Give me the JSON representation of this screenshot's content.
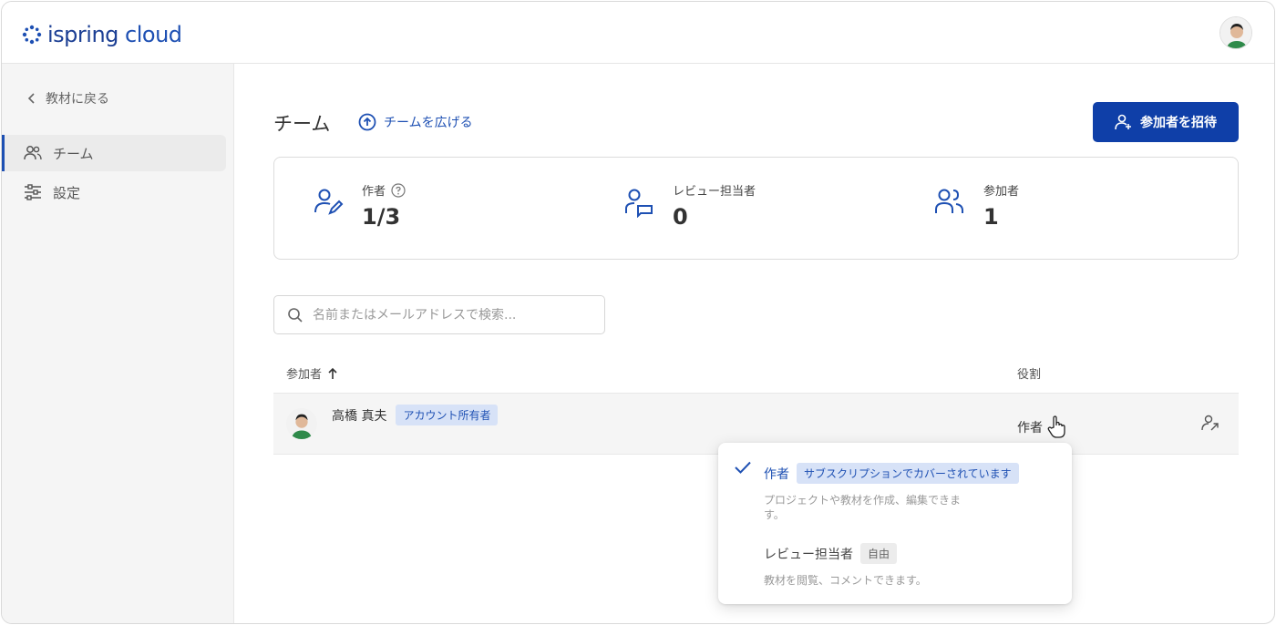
{
  "app": {
    "logo_main": "ispring",
    "logo_sub": "cloud"
  },
  "sidebar": {
    "back_label": "教材に戻る",
    "items": [
      {
        "label": "チーム",
        "icon": "users-icon",
        "active": true
      },
      {
        "label": "設定",
        "icon": "sliders-icon",
        "active": false
      }
    ]
  },
  "header": {
    "title": "チーム",
    "expand_label": "チームを広げる",
    "invite_label": "参加者を招待"
  },
  "stats": [
    {
      "label": "作者",
      "value": "1/3",
      "icon": "user-edit-icon",
      "has_help": true
    },
    {
      "label": "レビュー担当者",
      "value": "0",
      "icon": "user-comment-icon",
      "has_help": false
    },
    {
      "label": "参加者",
      "value": "1",
      "icon": "users-icon",
      "has_help": false
    }
  ],
  "search": {
    "placeholder": "名前またはメールアドレスで検索..."
  },
  "table": {
    "col_member": "参加者",
    "col_role": "役割",
    "rows": [
      {
        "name": "高橋 真夫",
        "badge": "アカウント所有者",
        "role": "作者"
      }
    ]
  },
  "role_menu": {
    "options": [
      {
        "title": "作者",
        "badge": "サブスクリプションでカバーされています",
        "desc": "プロジェクトや教材を作成、編集できます。",
        "selected": true
      },
      {
        "title": "レビュー担当者",
        "badge": "自由",
        "desc": "教材を閲覧、コメントできます。",
        "selected": false
      }
    ]
  },
  "colors": {
    "brand": "#1e50b3",
    "button": "#0f3fa8",
    "badge_bg": "#d7e2f7"
  }
}
